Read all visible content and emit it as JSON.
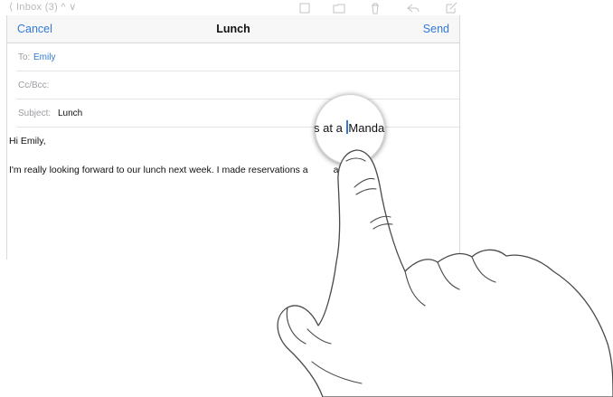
{
  "background_toolbar": {
    "inbox_label": "⟨ Inbox (3)  ^  ∨"
  },
  "compose": {
    "cancel_label": "Cancel",
    "title": "Lunch",
    "send_label": "Send",
    "to_label": "To:",
    "to_value": "Emily",
    "ccbcc_label": "Cc/Bcc:",
    "subject_label": "Subject:",
    "subject_value": "Lunch",
    "greeting": "Hi Emily,",
    "body_line": "I'm really looking forward to our lunch next week. I made reservations a",
    "body_line_tail": "arin"
  },
  "loupe": {
    "before_cursor": "s at a ",
    "after_cursor": "Manda"
  },
  "colors": {
    "accent": "#2f7ad6",
    "cursor": "#2f7ad6"
  }
}
